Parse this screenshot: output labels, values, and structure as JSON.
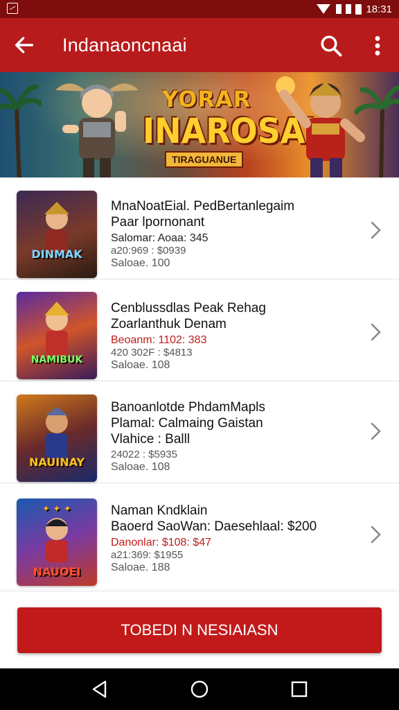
{
  "status_bar": {
    "time": "18:31",
    "left_icon": "gallery-icon",
    "right_icons": [
      "wifi-icon",
      "signal-icon",
      "signal-icon",
      "battery-icon"
    ]
  },
  "app_bar": {
    "title": "Indanaoncnaai",
    "back_icon": "arrow-left-icon",
    "search_icon": "search-icon",
    "more_icon": "more-vert-icon",
    "color": "#b81b1b"
  },
  "banner": {
    "logo_top": "YORAR",
    "logo_main": "INAROSAN",
    "logo_sub": "TIRAGUANUE"
  },
  "items": [
    {
      "thumb_caption": "DINMAK",
      "title": "MnaNoatEial. PedBertanlegaim",
      "subtitle": "Paar lpornonant",
      "line3": "Salomar: Aoaa: 345",
      "line3_red": false,
      "line4": "a20:969 : $0939",
      "line5": "Saloae. 100"
    },
    {
      "thumb_caption": "NAMIBUK",
      "title": "Cenblussdlas Peak Rehag",
      "subtitle": "Zoarlanthuk Denam",
      "line3": "Beoanm: 1102: 383",
      "line3_red": true,
      "line4": "420 302F : $4813",
      "line5": "Saloae. 108"
    },
    {
      "thumb_caption": "NAUINAY",
      "title": "Banoanlotde PhdamMapls",
      "subtitle": "Plamal: Calmaing Gaistan",
      "line3": "Vlahice : Balll",
      "line3_red": false,
      "line4": "24022 : $5935",
      "line5": "Saloae. 108"
    },
    {
      "thumb_caption": "NAUOEI",
      "title": "Naman Kndklain",
      "subtitle": "Baoerd SaoWan: Daesehlaal: $200",
      "line3": "Danonlar: $108: $47",
      "line3_red": true,
      "line4": "a21:369: $1955",
      "line5": "Saloae. 188"
    }
  ],
  "cta": {
    "label": "TOBEDI N NESIAIASN",
    "color": "#c21a1a"
  },
  "nav_bar": {
    "icons": [
      "back-triangle-icon",
      "home-circle-icon",
      "recents-square-icon"
    ]
  }
}
